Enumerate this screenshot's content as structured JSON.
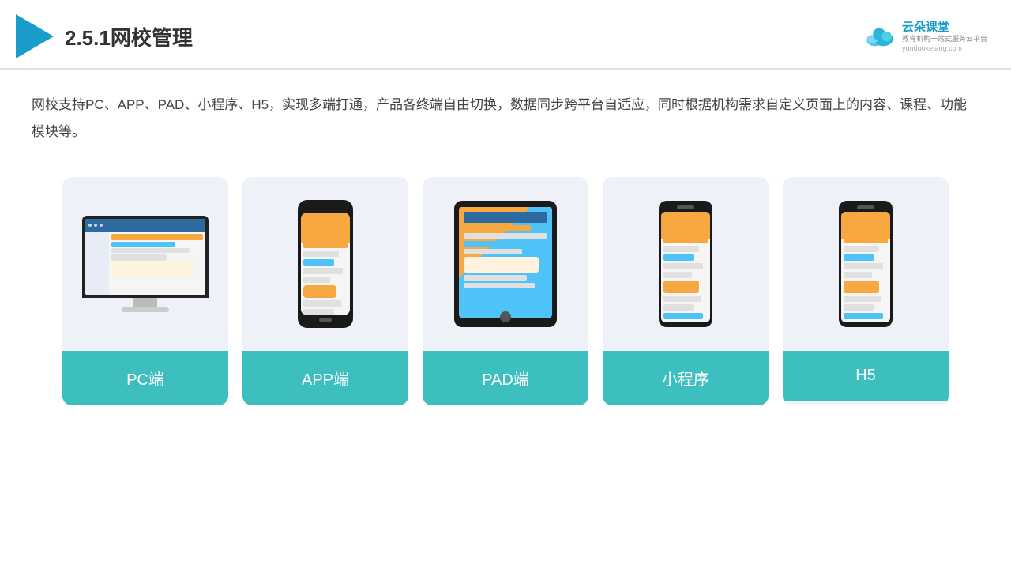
{
  "header": {
    "title": "2.5.1网校管理",
    "brand_name": "云朵课堂",
    "brand_url": "yunduoketang.com",
    "brand_tagline1": "教育机构一站",
    "brand_tagline2": "式服务云平台"
  },
  "description": {
    "text": "网校支持PC、APP、PAD、小程序、H5，实现多端打通，产品各终端自由切换，数据同步跨平台自适应，同时根据机构需求自定义页面上的内容、课程、功能模块等。"
  },
  "cards": [
    {
      "id": "pc",
      "label": "PC端"
    },
    {
      "id": "app",
      "label": "APP端"
    },
    {
      "id": "pad",
      "label": "PAD端"
    },
    {
      "id": "miniprogram",
      "label": "小程序"
    },
    {
      "id": "h5",
      "label": "H5"
    }
  ]
}
